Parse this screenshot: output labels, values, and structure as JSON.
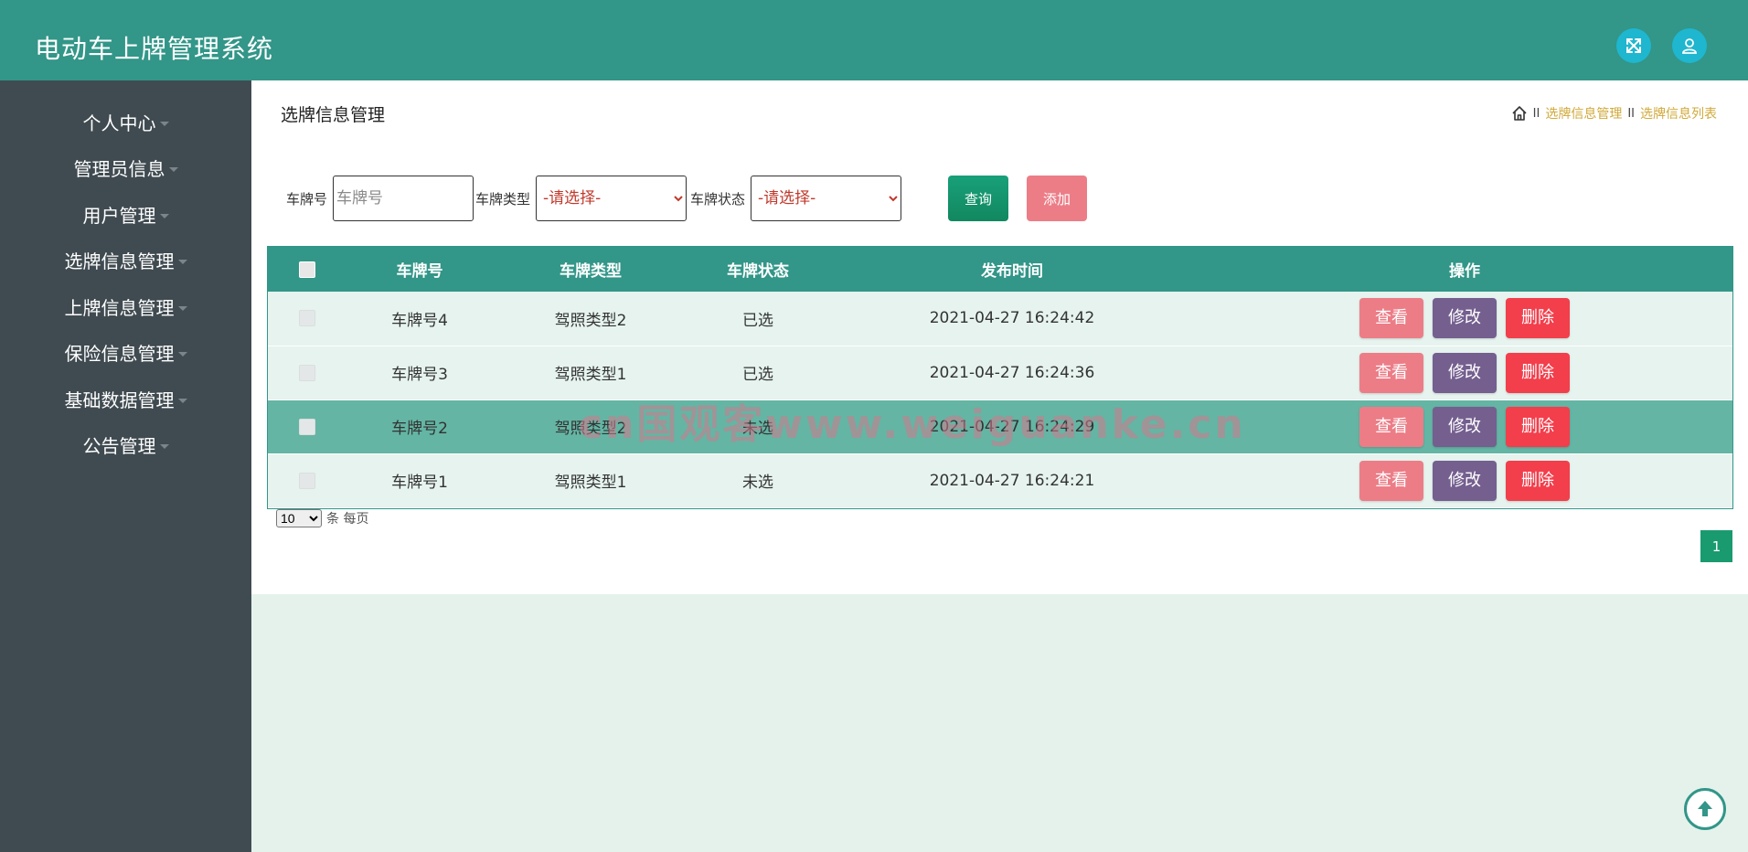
{
  "header": {
    "title": "电动车上牌管理系统",
    "icons": [
      "fullscreen-icon",
      "user-icon"
    ],
    "color": "#329688"
  },
  "sidebar": {
    "items": [
      {
        "label": "个人中心"
      },
      {
        "label": "管理员信息"
      },
      {
        "label": "用户管理"
      },
      {
        "label": "选牌信息管理"
      },
      {
        "label": "上牌信息管理"
      },
      {
        "label": "保险信息管理"
      },
      {
        "label": "基础数据管理"
      },
      {
        "label": "公告管理"
      }
    ]
  },
  "page": {
    "title": "选牌信息管理",
    "breadcrumb": [
      "选牌信息管理",
      "选牌信息列表"
    ],
    "breadcrumb_sep": "II"
  },
  "search": {
    "plate_label": "车牌号",
    "plate_placeholder": "车牌号",
    "type_label": "车牌类型",
    "type_selected": "-请选择-",
    "status_label": "车牌状态",
    "status_selected": "-请选择-",
    "query_label": "查询",
    "add_label": "添加"
  },
  "table": {
    "headers": [
      "车牌号",
      "车牌类型",
      "车牌状态",
      "发布时间",
      "操作"
    ],
    "rows": [
      {
        "plate": "车牌号4",
        "type": "驾照类型2",
        "status": "已选",
        "time": "2021-04-27 16:24:42"
      },
      {
        "plate": "车牌号3",
        "type": "驾照类型1",
        "status": "已选",
        "time": "2021-04-27 16:24:36"
      },
      {
        "plate": "车牌号2",
        "type": "驾照类型2",
        "status": "未选",
        "time": "2021-04-27 16:24:29"
      },
      {
        "plate": "车牌号1",
        "type": "驾照类型1",
        "status": "未选",
        "time": "2021-04-27 16:24:21"
      }
    ],
    "actions": {
      "view": "查看",
      "edit": "修改",
      "delete": "删除"
    }
  },
  "pager": {
    "page_size": "10",
    "page_size_suffix": "条 每页",
    "current_page": "1"
  },
  "watermark": "cn国观客www.weiguanke.cn",
  "colors": {
    "accent": "#329688",
    "sidebar": "#404b51",
    "view": "#ec7d87",
    "edit": "#745f8f",
    "delete": "#f33e4b",
    "breadcrumb": "#d0a93a"
  }
}
